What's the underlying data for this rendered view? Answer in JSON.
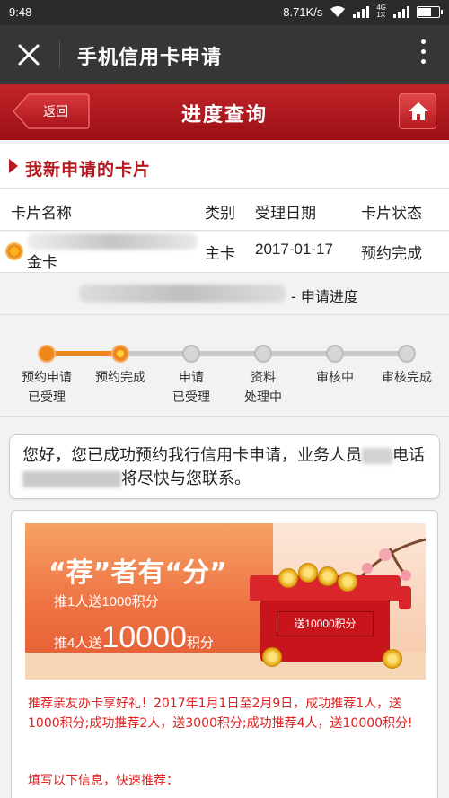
{
  "status_bar": {
    "time": "9:48",
    "net_speed": "8.71K/s",
    "net_type": "4G",
    "net_subtype": "1X"
  },
  "app_bar": {
    "title": "手机信用卡申请",
    "close_icon": "close-icon",
    "more_icon": "more-vertical-icon"
  },
  "header": {
    "back_label": "返回",
    "title": "进度查询",
    "home_icon": "home-icon"
  },
  "section": {
    "title": "我新申请的卡片"
  },
  "table": {
    "headers": [
      "卡片名称",
      "类别",
      "受理日期",
      "卡片状态"
    ],
    "rows": [
      {
        "name": "金卡",
        "type": "主卡",
        "date": "2017-01-17",
        "status": "预约完成"
      }
    ]
  },
  "progress": {
    "label": "- 申请进度",
    "current_step": 2,
    "steps": [
      {
        "line1": "预约申请",
        "line2": "已受理"
      },
      {
        "line1": "预约完成",
        "line2": ""
      },
      {
        "line1": "申请",
        "line2": "已受理"
      },
      {
        "line1": "资料",
        "line2": "处理中"
      },
      {
        "line1": "审核中",
        "line2": ""
      },
      {
        "line1": "审核完成",
        "line2": ""
      }
    ]
  },
  "message": {
    "part1": "您好，您已成功预约我行信用卡申请，业务人员",
    "part2": "电话",
    "part3": "将尽快与您联系。"
  },
  "promo": {
    "banner_title": "“荐”者有“分”",
    "banner_line1": "推1人送1000积分",
    "banner_line2_prefix": "推4人送",
    "banner_line2_big": "10000",
    "banner_line2_suffix": "积分",
    "envelope_text": "送10000积分",
    "text": "推荐亲友办卡享好礼！2017年1月1日至2月9日，成功推荐1人，送1000积分;成功推荐2人，送3000积分;成功推荐4人，送10000积分!",
    "text2": "填写以下信息，快速推荐："
  },
  "colors": {
    "brand_red": "#b3191e",
    "progress_active": "#f08519",
    "progress_inactive": "#c8c8c8",
    "promo_text": "#e0201f"
  }
}
